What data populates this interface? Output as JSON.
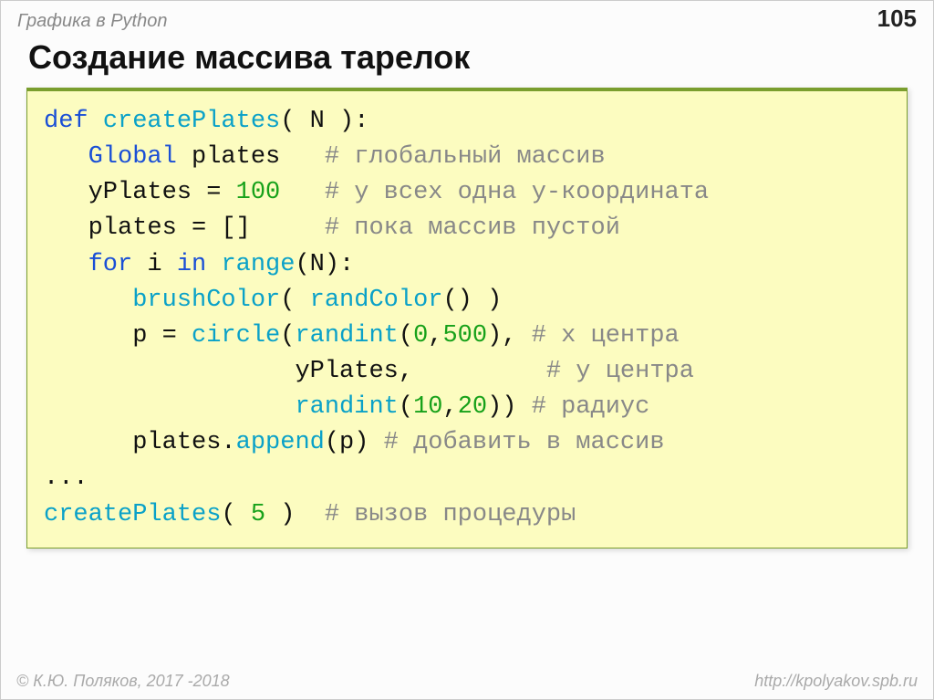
{
  "header": {
    "section": "Графика в Python",
    "page": "105"
  },
  "title": "Создание массива тарелок",
  "code": {
    "l1": {
      "p": "",
      "kw": "def",
      "sp": " ",
      "fn": "createPlates",
      "args": "( N ):"
    },
    "l2": {
      "p": "   ",
      "kw": "Global",
      "sp": " ",
      "id": "plates",
      "pad": "   ",
      "c": "# глобальный массив"
    },
    "l3": {
      "p": "   ",
      "id": "yPlates = ",
      "num": "100",
      "pad": "   ",
      "c": "# у всех одна y-координата"
    },
    "l4": {
      "p": "   ",
      "id": "plates = []",
      "pad": "     ",
      "c": "# пока массив пустой"
    },
    "l5": {
      "p": "   ",
      "kw": "for",
      "a": " i ",
      "kw2": "in",
      "sp": " ",
      "fn": "range",
      "args": "(N):"
    },
    "l6": {
      "p": "      ",
      "fn": "brushColor",
      "a": "( ",
      "fn2": "randColor",
      "b": "() )"
    },
    "l7": {
      "p": "      ",
      "id": "p = ",
      "fn": "circle",
      "a": "(",
      "fn2": "randint",
      "b": "(",
      "n1": "0",
      "c1": ",",
      "n2": "500",
      "d": "), ",
      "cm": "# x центра"
    },
    "l8": {
      "p": "                 ",
      "id": "yPlates,",
      "pad": "         ",
      "cm": "# y центра"
    },
    "l9": {
      "p": "                 ",
      "fn": "randint",
      "a": "(",
      "n1": "10",
      "c1": ",",
      "n2": "20",
      "b": ")) ",
      "cm": "# радиус"
    },
    "l10": {
      "p": "      ",
      "id": "plates.",
      "fn": "append",
      "a": "(p) ",
      "cm": "# добавить в массив"
    },
    "l11": {
      "p": "",
      "id": "..."
    },
    "l12": {
      "p": "",
      "fn": "createPlates",
      "a": "( ",
      "n": "5",
      "b": " )  ",
      "cm": "# вызов процедуры"
    }
  },
  "footer": {
    "left": "© К.Ю. Поляков, 2017 -2018",
    "right": "http://kpolyakov.spb.ru"
  }
}
